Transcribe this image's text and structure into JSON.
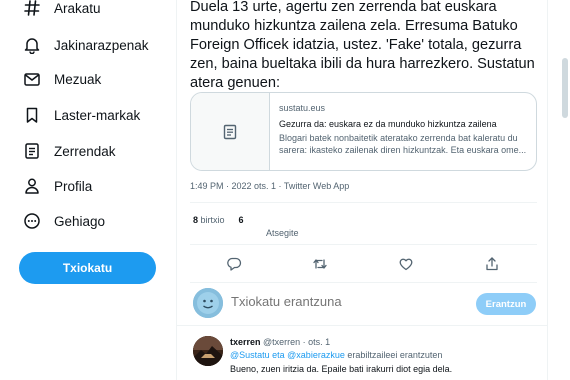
{
  "sidebar": {
    "items": [
      {
        "label": "Arakatu",
        "icon": "hashtag-icon"
      },
      {
        "label": "Jakinarazpenak",
        "icon": "bell-icon"
      },
      {
        "label": "Mezuak",
        "icon": "envelope-icon"
      },
      {
        "label": "Laster-markak",
        "icon": "bookmark-icon"
      },
      {
        "label": "Zerrendak",
        "icon": "list-icon"
      },
      {
        "label": "Profila",
        "icon": "person-icon"
      },
      {
        "label": "Gehiago",
        "icon": "more-circle-icon"
      }
    ],
    "tweet_button": "Txiokatu"
  },
  "tweet": {
    "text": "Duela 13 urte, agertu zen zerrenda bat euskara munduko hizkuntza zailena zela. Erresuma Batuko Foreign Officek idatzia, ustez. 'Fake' totala, gezurra zen, baina bueltaka ibili da hura harrezkero. Sustatun atera genuen:",
    "card": {
      "domain": "sustatu.eus",
      "title": "Gezurra da: euskara ez da munduko hizkuntza zailena",
      "description": "Blogari batek nonbaitetik ateratako zerrenda bat kaleratu du sarera: ikasteko zailenak diren hizkuntzak. Eta euskara ome..."
    },
    "meta": "1:49 PM · 2022 ots. 1 · Twitter Web App",
    "stats": {
      "retweets_count": "8",
      "retweets_label": "birtxio",
      "likes_count": "6",
      "likes_label": "Atsegite"
    }
  },
  "reply_box": {
    "placeholder": "Txiokatu erantzuna",
    "button": "Erantzun"
  },
  "reply": {
    "name": "txerren",
    "handle": "@txerren · ots. 1",
    "mention_prefix": "",
    "mention_links": "@Sustatu eta @xabierazkue",
    "mention_suffix": "erabiltzaileei erantzuten",
    "text": "Bueno, zuen iritzia da. Epaile bati irakurri diot egia dela."
  },
  "colors": {
    "accent": "#1d9bf0",
    "text": "#0f1419",
    "muted": "#536471"
  }
}
